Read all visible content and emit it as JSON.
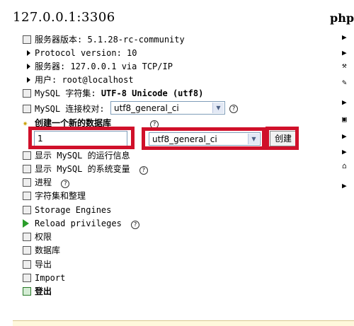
{
  "header": {
    "title": "127.0.0.1:3306",
    "brand": "phpM"
  },
  "server_info": {
    "version": "服务器版本: 5.1.28-rc-community",
    "protocol": "Protocol version: 10",
    "server": "服务器: 127.0.0.1 via TCP/IP",
    "user": "用户: root@localhost"
  },
  "charset": {
    "label": "MySQL 字符集:",
    "value": "UTF-8 Unicode (utf8)"
  },
  "collation": {
    "label": "MySQL 连接校对:",
    "selected": "utf8_general_ci"
  },
  "create_db": {
    "heading": "创建一个新的数据库",
    "name_value": "1",
    "collation_selected": "utf8_general_ci",
    "button_label": "创建"
  },
  "menu": {
    "runtime_info": "显示 MySQL 的运行信息",
    "system_vars": "显示 MySQL 的系统变量",
    "processes": "进程",
    "charsets": "字符集和整理",
    "storage_engines": "Storage Engines",
    "reload_privileges": "Reload privileges",
    "privileges": "权限",
    "databases": "数据库",
    "export": "导出",
    "import": "Import",
    "logout": "登出"
  },
  "help_symbol": "?",
  "colors": {
    "highlight": "#d0102a",
    "input_border": "#7f9db9"
  }
}
